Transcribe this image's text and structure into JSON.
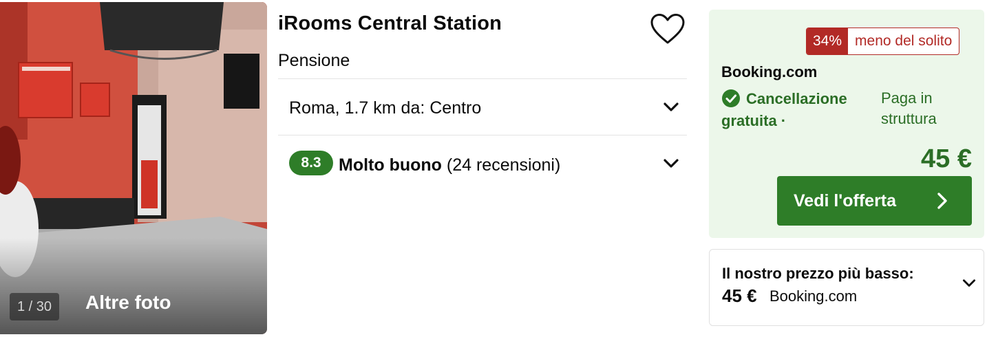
{
  "photo": {
    "counter": "1 / 30",
    "more_label": "Altre foto"
  },
  "hotel": {
    "name": "iRooms Central Station",
    "type": "Pensione",
    "location": "Roma, 1.7 km da: Centro",
    "rating": {
      "score": "8.3",
      "label": "Molto buono",
      "reviews": "(24 recensioni)"
    }
  },
  "offer": {
    "deal_percent": "34%",
    "deal_text": "meno del solito",
    "provider": "Booking.com",
    "cancellation": "Cancellazione gratuita ·",
    "payment": "Paga in struttura",
    "price": "45 €",
    "cta_label": "Vedi l'offerta"
  },
  "lowest": {
    "label": "Il nostro prezzo più basso:",
    "price": "45 €",
    "provider": "Booking.com"
  },
  "colors": {
    "green": "#2e7d28",
    "green_text": "#2b6e26",
    "deal_red": "#b22a26",
    "offer_bg": "#ecf7ea"
  },
  "icons": [
    "heart-icon",
    "chevron-down-icon",
    "check-circle-icon",
    "chevron-right-icon"
  ]
}
